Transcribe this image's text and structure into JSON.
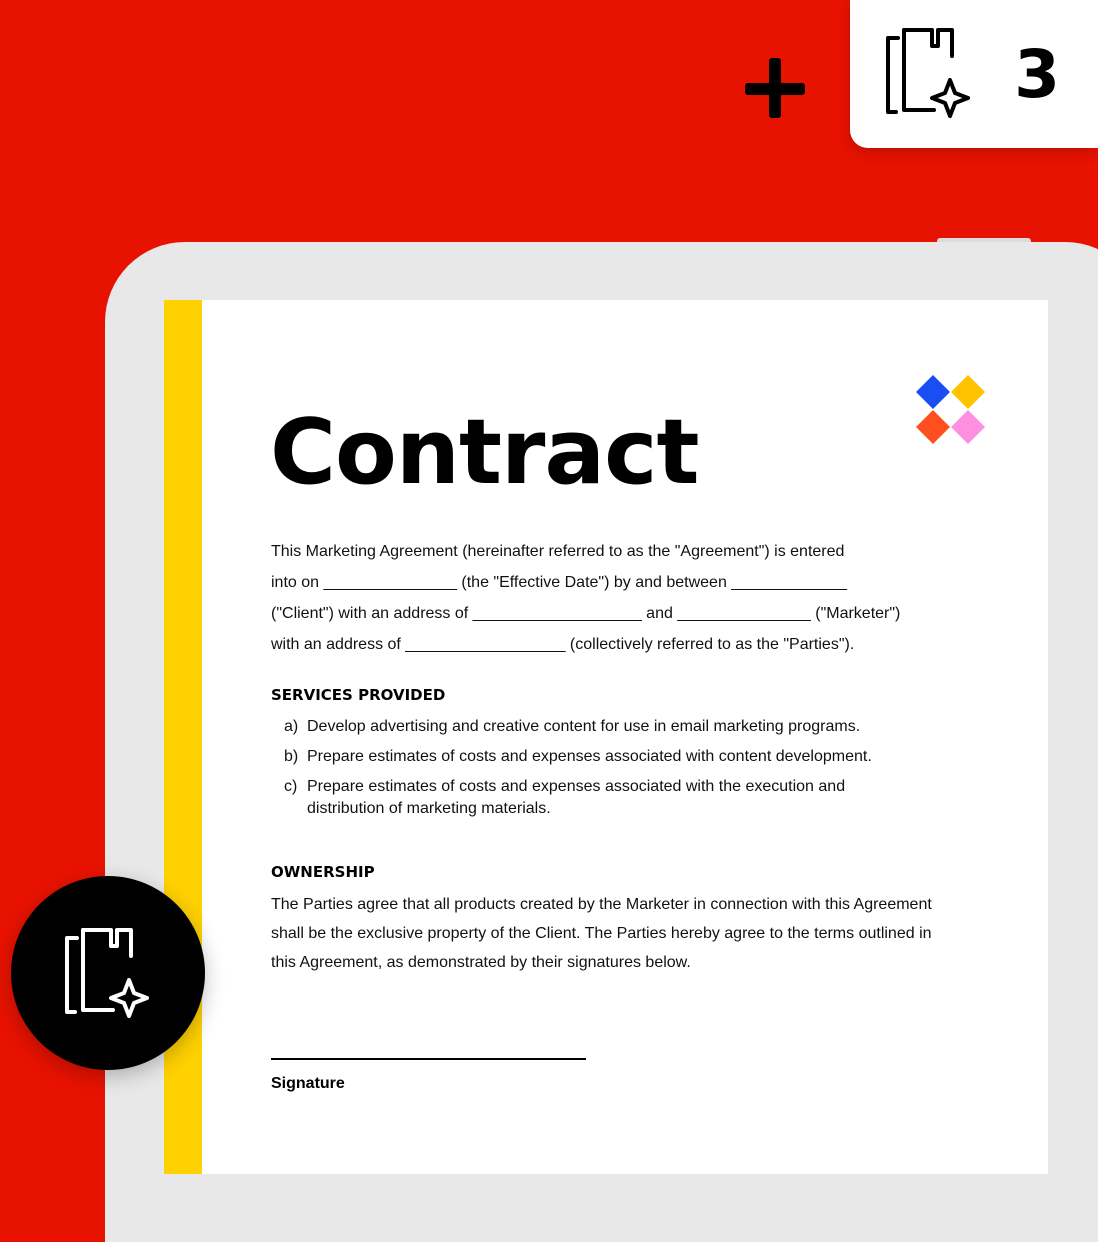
{
  "badge": {
    "icon": "documents-sparkle-icon",
    "count": "3"
  },
  "add_icon": "plus-icon",
  "document": {
    "logo": "four-diamond-logo",
    "logo_colors": [
      "#1a4ef2",
      "#ffc400",
      "#ff4f1f",
      "#ff8fe0"
    ],
    "title": "Contract",
    "intro_lines": [
      "This Marketing Agreement (hereinafter referred to as the \"Agreement\") is entered",
      "into on _______________ (the \"Effective Date\") by and between _____________",
      "(\"Client\") with an address of ___________________ and _______________ (\"Marketer\")",
      "with an address of __________________ (collectively referred to as the \"Parties\")."
    ],
    "services": {
      "heading": "SERVICES PROVIDED",
      "items": [
        {
          "marker": "a)",
          "text": "Develop advertising and creative content for use in email marketing programs."
        },
        {
          "marker": "b)",
          "text": "Prepare estimates of costs and expenses associated with content development."
        },
        {
          "marker": "c)",
          "text": "Prepare estimates of costs and expenses associated with the execution and distribution of marketing materials."
        }
      ]
    },
    "ownership": {
      "heading": "OWNERSHIP",
      "lines": [
        "The Parties agree that all products created by the Marketer in connection with this Agreement",
        "shall be the exclusive property of the Client. The Parties hereby agree to the terms outlined in",
        "this Agreement, as demonstrated by their signatures below."
      ]
    },
    "signature_label": "Signature"
  },
  "fab": {
    "icon": "documents-sparkle-icon"
  },
  "colors": {
    "background": "#e81200",
    "stripe": "#ffd100"
  }
}
